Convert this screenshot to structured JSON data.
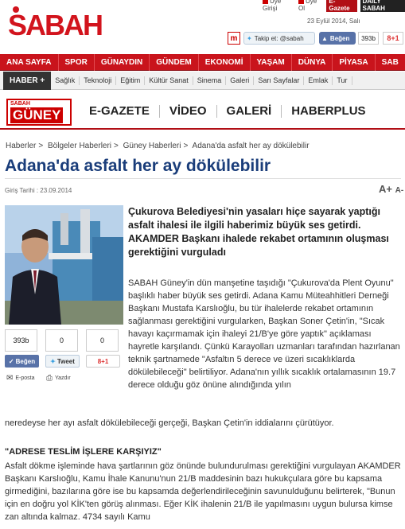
{
  "brand": {
    "logo": "SABAH"
  },
  "toplinks": [
    "Üye Girişi",
    "Üye Ol",
    "E-Gazete",
    "DAILY SABAH"
  ],
  "date": "23 Eylül 2014, Salı",
  "social": {
    "m_icon": "m",
    "twitter_label": "Takip et: @sabah",
    "like_label": "Beğen",
    "like_count": "393b",
    "gplus": "8+1"
  },
  "nav_main": [
    "ANA SAYFA",
    "SPOR",
    "GÜNAYDIN",
    "GÜNDEM",
    "EKONOMİ",
    "YAŞAM",
    "DÜNYA",
    "PİYASA",
    "SAB"
  ],
  "nav_sub": {
    "active": "HABER +",
    "items": [
      "Sağlık",
      "Teknoloji",
      "Eğitim",
      "Kültür Sanat",
      "Sinema",
      "Galeri",
      "Sarı Sayfalar",
      "Emlak",
      "Tur"
    ]
  },
  "section": {
    "logo_small": "SABAH",
    "logo_main": "GÜNEY",
    "links": [
      "E-GAZETE",
      "VİDEO",
      "GALERİ",
      "HABERPLUS"
    ]
  },
  "breadcrumb": [
    "Haberler",
    "Bölgeler Haberleri",
    "Güney Haberleri",
    "Adana'da asfalt her ay dökülebilir"
  ],
  "breadcrumb_sep": ">",
  "article": {
    "title": "Adana'da asfalt her ay dökülebilir",
    "published": "Giriş Tarihi : 23.09.2014",
    "font_up": "A+",
    "font_down": "A-",
    "lead": "Çukurova Belediyesi'nin yasaları hiçe sayarak yaptığı asfalt ihalesi ile ilgili haberimiz büyük ses getirdi. AKAMDER Başkanı ihalede rekabet ortamının oluşması gerektiğini vurguladı",
    "para1": "SABAH Güney'in dün manşetine taşıdığı \"Çukurova'da Plent Oyunu\" başlıklı haber büyük ses getirdi. Adana Kamu Müteahhitleri Derneği Başkanı Mustafa Karslıoğlu, bu tür ihalelerde rekabet ortamının sağlanması gerektiğini vurgularken, Başkan Soner Çetin'in, \"Sıcak havayı kaçırmamak için ihaleyi 21/B'ye göre yaptık\" açıklaması hayretle karşılandı. Çünkü Karayolları uzmanları tarafından hazırlanan teknik şartnamede \"Asfaltın 5 derece ve üzeri sıcaklıklarda dökülebileceği\" belirtiliyor. Adana'nın yıllık sıcaklık ortalamasının 19.7 derece olduğu göz önüne alındığında yılın",
    "para1_cont": "neredeyse her ayı asfalt dökülebileceği gerçeği, Başkan Çetin'in iddialarını çürütüyor.",
    "subheading": "\"ADRESE TESLİM İŞLERE KARŞIYIZ\"",
    "para2": "Asfalt dökme işleminde hava şartlarının göz önünde bulundurulması gerektiğini vurgulayan AKAMDER Başkanı Karslıoğlu, Kamu İhale Kanunu'nun 21/B maddesinin bazı hukukçulara göre bu kapsama girmediğini, bazılarına göre ise bu kapsamda değerlendirileceğinin savunulduğunu belirterek, \"Bunun için en doğru yol KİK'ten görüş alınması. Eğer KİK ihalenin 21/B ile yapılmasını uygun bulursa kimse zan altında kalmaz. 4734 sayılı Kamu"
  },
  "share": {
    "like_count": "393b",
    "tweet_count": "0",
    "gplus_count": "0",
    "like_label": "Beğen",
    "tweet_label": "Tweet",
    "gplus_label": "8+1",
    "email_label": "E-posta",
    "print_label": "Yazdır"
  },
  "colors": {
    "brand_red": "#c9141c",
    "title_blue": "#1a3d7a",
    "facebook": "#5872a8"
  }
}
